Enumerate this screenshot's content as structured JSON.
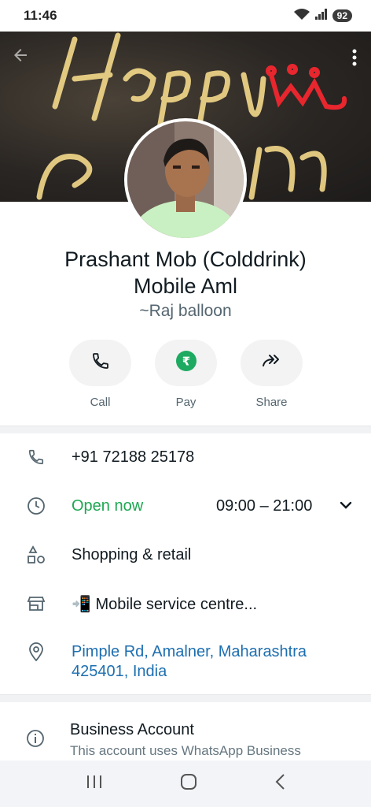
{
  "status_bar": {
    "time": "11:46",
    "battery": "92"
  },
  "cover": {
    "back_icon": "arrow-back-icon",
    "menu_icon": "more-vert-icon"
  },
  "profile": {
    "name_line1": "Prashant Mob (Colddrink)",
    "name_line2": "Mobile Aml",
    "subname": "~Raj balloon"
  },
  "actions": [
    {
      "label": "Call",
      "icon": "phone-icon"
    },
    {
      "label": "Pay",
      "icon": "rupee-icon"
    },
    {
      "label": "Share",
      "icon": "forward-icon"
    }
  ],
  "info": {
    "phone": "+91 72188 25178",
    "open_status": "Open now",
    "hours": "09:00 – 21:00",
    "category": "Shopping & retail",
    "description": "📲 Mobile service centre...",
    "address_line1": "Pimple Rd, Amalner, Maharashtra",
    "address_line2": "425401, India"
  },
  "business": {
    "title": "Business Account",
    "subtitle": "This account uses WhatsApp Business"
  },
  "colors": {
    "accent_green": "#1da851",
    "link_blue": "#1d6fb0",
    "pay_green": "#1daa61"
  }
}
